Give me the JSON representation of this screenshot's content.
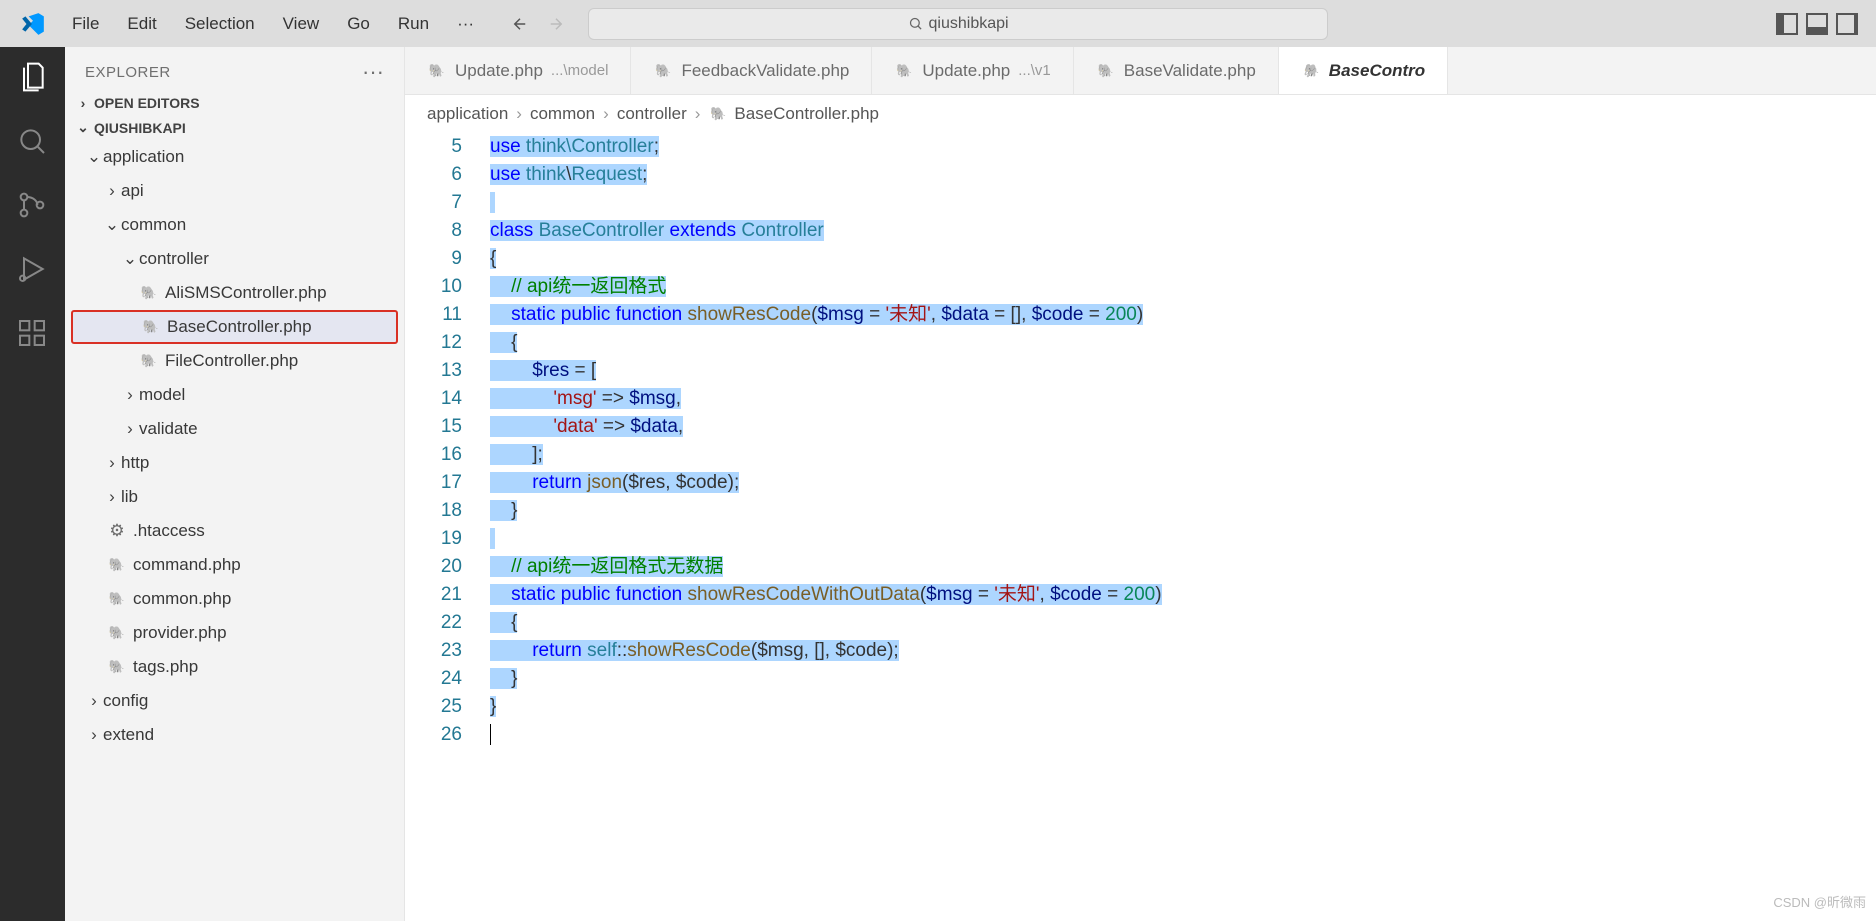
{
  "menu": {
    "file": "File",
    "edit": "Edit",
    "selection": "Selection",
    "view": "View",
    "go": "Go",
    "run": "Run",
    "more": "···"
  },
  "search_text": "qiushibkapi",
  "sidebar": {
    "title": "EXPLORER",
    "open_editors": "OPEN EDITORS",
    "project": "QIUSHIBKAPI",
    "tree": {
      "application": "application",
      "api": "api",
      "common": "common",
      "controller": "controller",
      "alisms": "AliSMSController.php",
      "base": "BaseController.php",
      "filectrl": "FileController.php",
      "model": "model",
      "validate": "validate",
      "http": "http",
      "lib": "lib",
      "htaccess": ".htaccess",
      "command": "command.php",
      "commonphp": "common.php",
      "provider": "provider.php",
      "tags": "tags.php",
      "config": "config",
      "extend": "extend"
    }
  },
  "tabs": [
    {
      "label": "Update.php",
      "dim": "...\\model"
    },
    {
      "label": "FeedbackValidate.php",
      "dim": ""
    },
    {
      "label": "Update.php",
      "dim": "...\\v1"
    },
    {
      "label": "BaseValidate.php",
      "dim": ""
    },
    {
      "label": "BaseContro",
      "dim": ""
    }
  ],
  "breadcrumb": {
    "p1": "application",
    "p2": "common",
    "p3": "controller",
    "file": "BaseController.php"
  },
  "code": {
    "l5": "use think\\Controller;",
    "l6": "use think\\Request;",
    "l8_class": "class ",
    "l8_name": "BaseController ",
    "l8_ext": "extends ",
    "l8_sup": "Controller",
    "l10_cmt": "// api统一返回格式",
    "l11_static": "static ",
    "l11_pub": "public ",
    "l11_fn": "function ",
    "l11_name": "showResCode",
    "l11_sig1": "(",
    "l11_v1": "$msg",
    "l11_eq": " = ",
    "l11_str1": "'未知'",
    "l11_c": ", ",
    "l11_v2": "$data",
    "l11_eq2": " = [], ",
    "l11_v3": "$code",
    "l11_eq3": " = ",
    "l11_num": "200",
    "l11_close": ")",
    "l13": "$res = [",
    "l14_k": "'msg'",
    "l14_arrow": " => ",
    "l14_v": "$msg",
    "l14_c": ",",
    "l15_k": "'data'",
    "l15_arrow": " => ",
    "l15_v": "$data",
    "l15_c": ",",
    "l16": "];",
    "l17_ret": "return ",
    "l17_fn": "json",
    "l17_args": "($res, $code);",
    "l20_cmt": "// api统一返回格式无数据",
    "l21_static": "static ",
    "l21_pub": "public ",
    "l21_fn": "function ",
    "l21_name": "showResCodeWithOutData",
    "l21_open": "(",
    "l21_v1": "$msg",
    "l21_eq": " = ",
    "l21_str": "'未知'",
    "l21_c": ", ",
    "l21_v2": "$code",
    "l21_eq2": " = ",
    "l21_num": "200",
    "l21_close": ")",
    "l23_ret": "return ",
    "l23_self": "self",
    "l23_op": "::",
    "l23_fn": "showResCode",
    "l23_args": "($msg, [], $code);"
  },
  "watermark": "CSDN @昕微雨"
}
